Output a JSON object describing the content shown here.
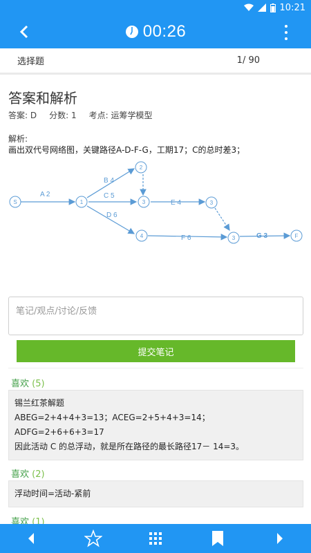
{
  "status": {
    "time": "10:21"
  },
  "appbar": {
    "timer": "00:26"
  },
  "question_bar": {
    "type": "选择题",
    "progress": "1/ 90"
  },
  "answer": {
    "title": "答案和解析",
    "answer_text": "答案: D",
    "score_text": "分数: 1",
    "topic_text": "考点: 运筹学模型",
    "analysis_label": "解析:",
    "analysis_text": "画出双代号网络图，关键路径A-D-F-G，工期17；C的总时差3；"
  },
  "network": {
    "nodes": [
      "S",
      "1",
      "2",
      "3",
      "3",
      "4",
      "3",
      "F"
    ],
    "edges": [
      "A 2",
      "B 4",
      "C 5",
      "D 6",
      "E 4",
      "F 6",
      "G 3"
    ]
  },
  "note": {
    "placeholder": "笔记/观点/讨论/反馈",
    "submit_label": "提交笔记"
  },
  "comments": [
    {
      "like_label": "喜欢",
      "like_count": "(5)",
      "lines": [
        "锡兰红茶解题",
        "ABEG=2+4+4+3=13；ACEG=2+5+4+3=14；",
        "ADFG=2+6+6+3=17",
        "因此活动  C  的总浮动，就是所在路径的最长路径17－  14=3。"
      ]
    },
    {
      "like_label": "喜欢",
      "like_count": "(2)",
      "lines": [
        "浮动时间=活动-紧前"
      ]
    },
    {
      "like_label": "喜欢",
      "like_count": "(1)",
      "lines": []
    }
  ],
  "colors": {
    "primary": "#2196f3",
    "accent_green": "#66b82a",
    "diagram": "#5b9bd5"
  },
  "icons": [
    "back-icon",
    "timer-icon",
    "more-icon",
    "prev-icon",
    "star-icon",
    "grid-icon",
    "bookmark-icon",
    "next-icon"
  ]
}
